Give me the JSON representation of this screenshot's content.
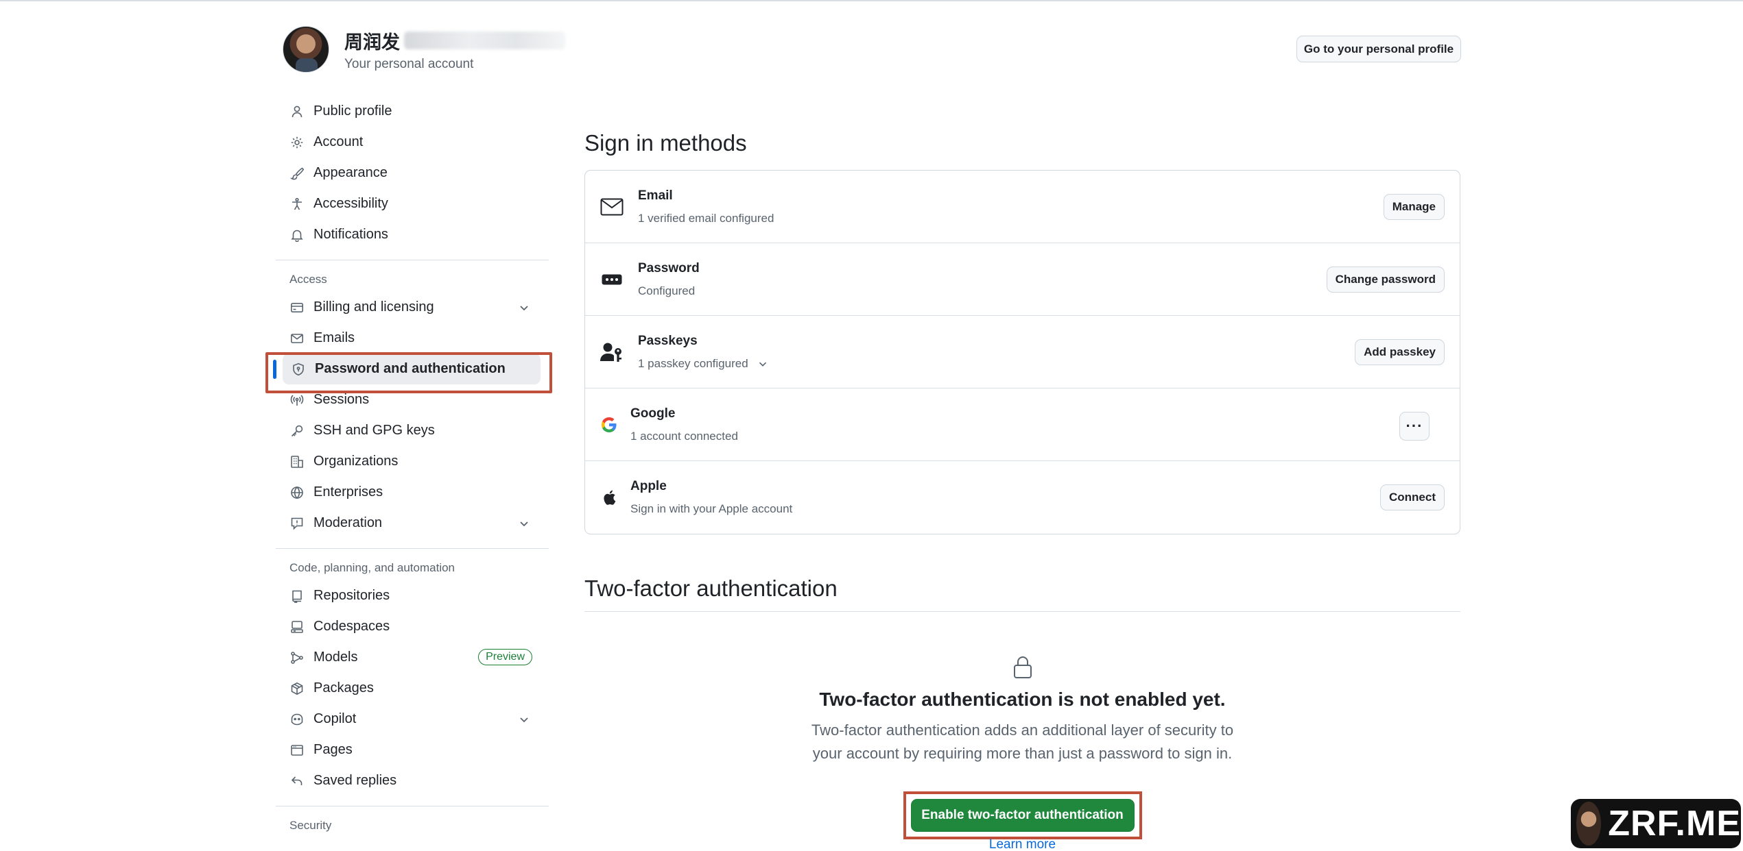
{
  "header": {
    "name": "周润发",
    "subtitle": "Your personal account",
    "go_profile_label": "Go to your personal profile"
  },
  "sidebar": {
    "items_top": [
      {
        "label": "Public profile",
        "icon": "person-icon"
      },
      {
        "label": "Account",
        "icon": "gear-icon"
      },
      {
        "label": "Appearance",
        "icon": "paintbrush-icon"
      },
      {
        "label": "Accessibility",
        "icon": "accessibility-icon"
      },
      {
        "label": "Notifications",
        "icon": "bell-icon"
      }
    ],
    "access_label": "Access",
    "items_access": [
      {
        "label": "Billing and licensing",
        "icon": "credit-card-icon"
      },
      {
        "label": "Emails",
        "icon": "mail-icon"
      },
      {
        "label": "Password and authentication",
        "icon": "shield-lock-icon"
      },
      {
        "label": "Sessions",
        "icon": "broadcast-icon"
      },
      {
        "label": "SSH and GPG keys",
        "icon": "key-icon"
      },
      {
        "label": "Organizations",
        "icon": "organization-icon"
      },
      {
        "label": "Enterprises",
        "icon": "globe-icon"
      },
      {
        "label": "Moderation",
        "icon": "report-icon"
      }
    ],
    "code_label": "Code, planning, and automation",
    "items_code": [
      {
        "label": "Repositories",
        "icon": "repo-icon"
      },
      {
        "label": "Codespaces",
        "icon": "codespaces-icon"
      },
      {
        "label": "Models",
        "icon": "models-icon",
        "badge": "Preview"
      },
      {
        "label": "Packages",
        "icon": "package-icon"
      },
      {
        "label": "Copilot",
        "icon": "copilot-icon"
      },
      {
        "label": "Pages",
        "icon": "browser-icon"
      },
      {
        "label": "Saved replies",
        "icon": "reply-icon"
      }
    ],
    "security_label": "Security"
  },
  "sign_in": {
    "title": "Sign in methods",
    "methods": [
      {
        "title": "Email",
        "subtitle": "1 verified email configured",
        "action": "Manage",
        "icon": "mail-icon"
      },
      {
        "title": "Password",
        "subtitle": "Configured",
        "action": "Change password",
        "icon": "password-icon"
      },
      {
        "title": "Passkeys",
        "subtitle": "1 passkey configured",
        "action": "Add passkey",
        "icon": "passkey-icon"
      },
      {
        "title": "Google",
        "subtitle": "1 account connected",
        "action": "···",
        "icon": "google-icon"
      },
      {
        "title": "Apple",
        "subtitle": "Sign in with your Apple account",
        "action": "Connect",
        "icon": "apple-icon"
      }
    ]
  },
  "two_factor": {
    "title": "Two-factor authentication",
    "heading": "Two-factor authentication is not enabled yet.",
    "description_line1": "Two-factor authentication adds an additional layer of security to",
    "description_line2": "your account by requiring more than just a password to sign in.",
    "enable_label": "Enable two-factor authentication",
    "learn_more": "Learn more"
  },
  "watermark": {
    "text": "ZRF.ME"
  },
  "colors": {
    "accent": "#0969da",
    "primary_green": "#1f883d",
    "highlight_border": "#c0503a"
  }
}
